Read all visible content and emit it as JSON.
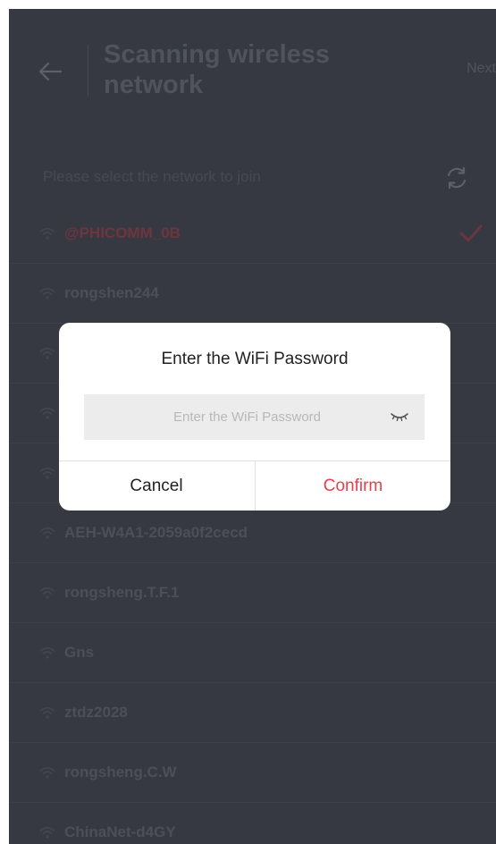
{
  "header": {
    "title": "Scanning wireless network",
    "next_label": "Next"
  },
  "subheader": {
    "text": "Please select the network to join"
  },
  "networks": [
    {
      "name": "@PHICOMM_0B",
      "selected": true
    },
    {
      "name": "rongshen244",
      "selected": false
    },
    {
      "name": "",
      "selected": false
    },
    {
      "name": "",
      "selected": false
    },
    {
      "name": "",
      "selected": false
    },
    {
      "name": "AEH-W4A1-2059a0f2cecd",
      "selected": false
    },
    {
      "name": "rongsheng.T.F.1",
      "selected": false
    },
    {
      "name": "Gns",
      "selected": false
    },
    {
      "name": "ztdz2028",
      "selected": false
    },
    {
      "name": "rongsheng.C.W",
      "selected": false
    },
    {
      "name": "ChinaNet-d4GY",
      "selected": false
    }
  ],
  "dialog": {
    "title": "Enter the WiFi Password",
    "password_value": "",
    "password_placeholder": "Enter the WiFi Password",
    "cancel_label": "Cancel",
    "confirm_label": "Confirm"
  },
  "icons": {
    "back": "arrow-left-icon",
    "refresh": "refresh-icon",
    "wifi": "wifi-icon",
    "check": "checkmark-icon",
    "eye": "eye-closed-icon"
  },
  "colors": {
    "background": "#3e414b",
    "accent": "#e6404d",
    "dialog_background": "#ffffff"
  }
}
